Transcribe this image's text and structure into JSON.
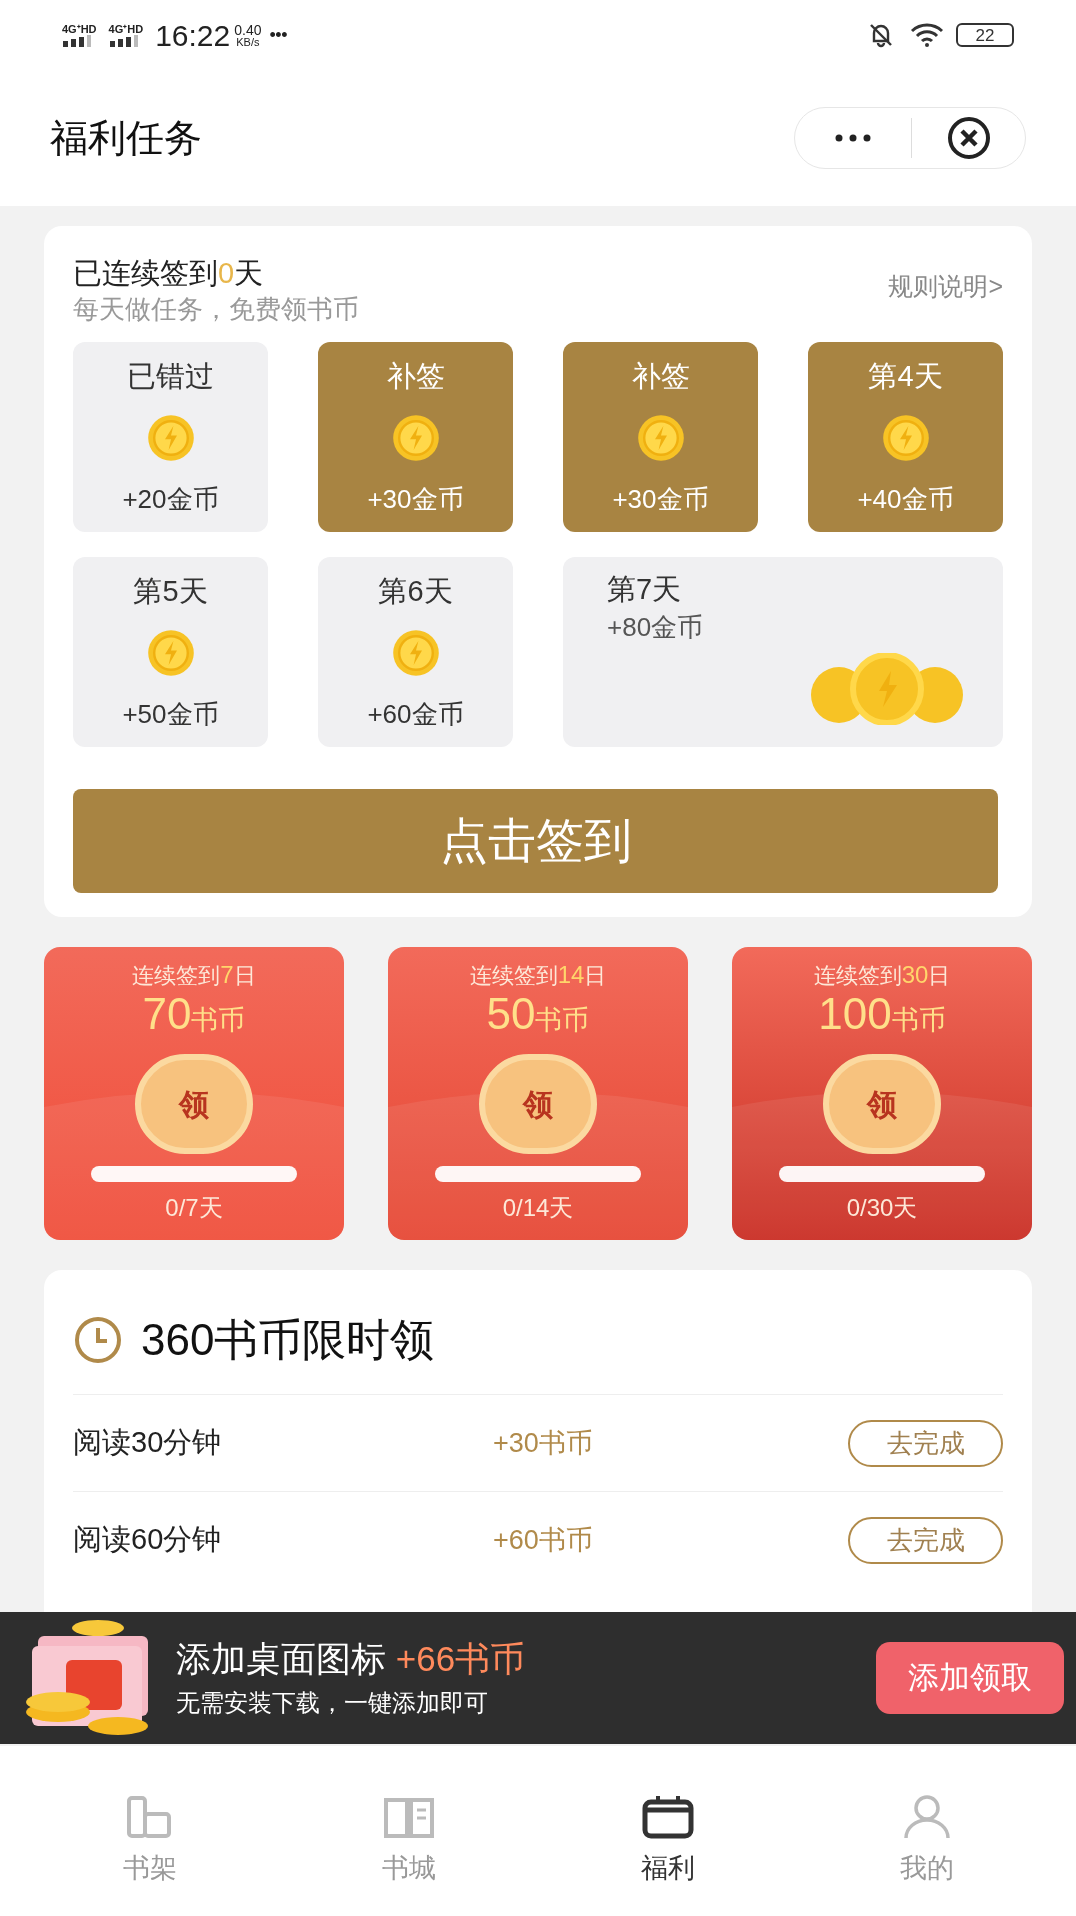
{
  "status_bar": {
    "signal_1": "4G⁺HD",
    "signal_2": "4G⁺HD",
    "time": "16:22",
    "speed_value": "0.40",
    "speed_unit": "KB/s",
    "more": "•••",
    "battery": "22"
  },
  "header": {
    "title": "福利任务"
  },
  "checkin": {
    "streak_prefix": "已连续签到",
    "streak_count": "0",
    "streak_suffix": "天",
    "subtitle": "每天做任务，免费领书币",
    "rules_link": "规则说明>",
    "days": [
      {
        "kind": "missed",
        "label": "已错过",
        "reward": "+20金币"
      },
      {
        "kind": "makeup",
        "label": "补签",
        "reward": "+30金币"
      },
      {
        "kind": "makeup",
        "label": "补签",
        "reward": "+30金币"
      },
      {
        "kind": "today",
        "label": "第4天",
        "reward": "+40金币"
      },
      {
        "kind": "future",
        "label": "第5天",
        "reward": "+50金币"
      },
      {
        "kind": "future",
        "label": "第6天",
        "reward": "+60金币"
      },
      {
        "kind": "bonus",
        "label": "第7天",
        "reward": "+80金币"
      }
    ],
    "button": "点击签到"
  },
  "streak_rewards": [
    {
      "prefix": "连续签到",
      "days": "7",
      "suffix": "日",
      "amount": "70",
      "unit": "书币",
      "claim": "领",
      "level": 0,
      "progress": "0/7天"
    },
    {
      "prefix": "连续签到",
      "days": "14",
      "suffix": "日",
      "amount": "50",
      "unit": "书币",
      "claim": "领",
      "level": 0,
      "progress": "0/14天"
    },
    {
      "prefix": "连续签到",
      "days": "30",
      "suffix": "日",
      "amount": "100",
      "unit": "书币",
      "claim": "领",
      "level": 0,
      "progress": "0/30天"
    }
  ],
  "tasks": {
    "title": "360书币限时领",
    "rows": [
      {
        "label": "阅读30分钟",
        "reward": "+30书币",
        "button": "去完成"
      },
      {
        "label": "阅读60分钟",
        "reward": "+60书币",
        "button": "去完成"
      }
    ]
  },
  "banner": {
    "title": "添加桌面图标",
    "highlight": "+66书币",
    "subtitle": "无需安装下载，一键添加即可",
    "button": "添加领取"
  },
  "tab_bar": [
    {
      "label": "书架",
      "selected": false
    },
    {
      "label": "书城",
      "selected": false
    },
    {
      "label": "福利",
      "selected": true
    },
    {
      "label": "我的",
      "selected": false
    }
  ]
}
